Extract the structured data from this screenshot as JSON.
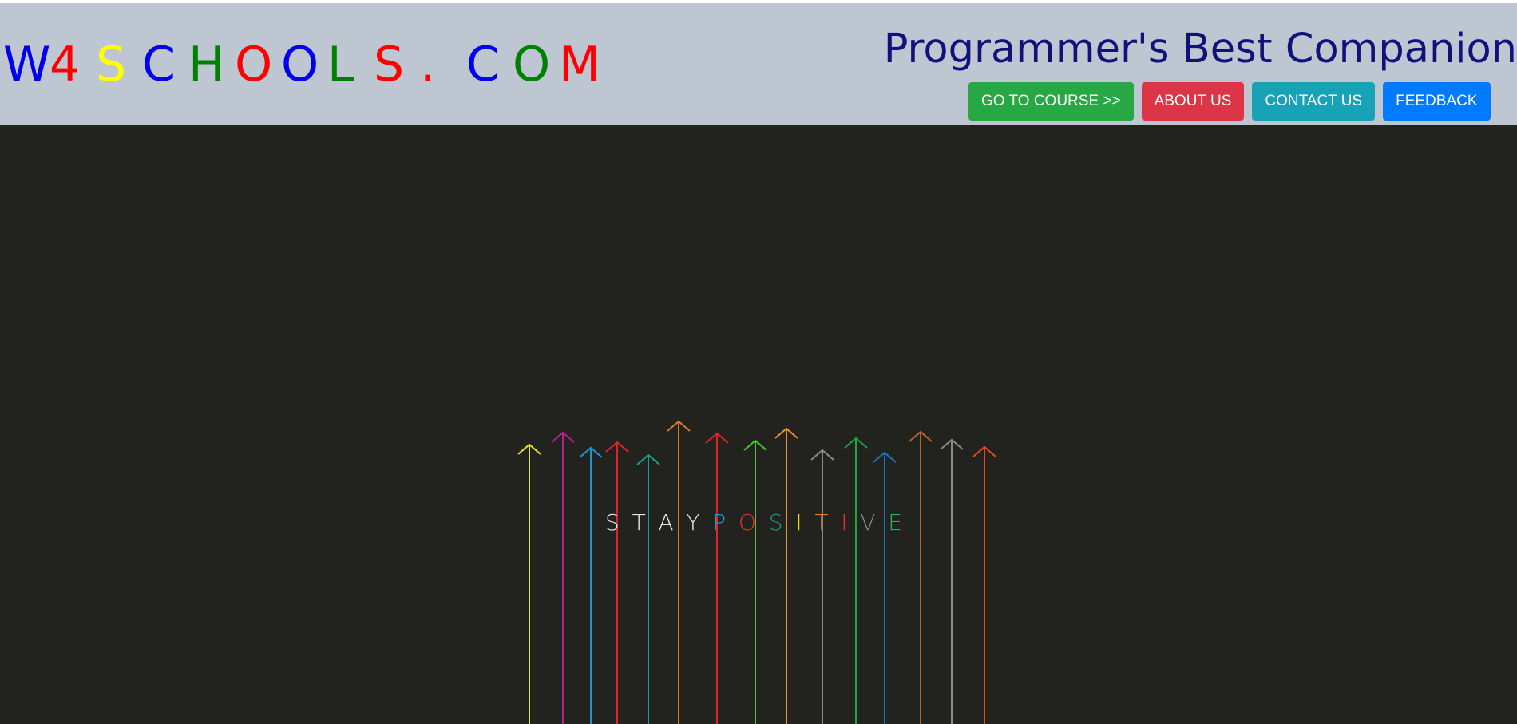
{
  "header": {
    "logo_letters": [
      {
        "char": "W",
        "color": "#0000ee"
      },
      {
        "char": "4",
        "color": "#ff0000"
      },
      {
        "char": "S",
        "color": "#ffff00"
      },
      {
        "char": "C",
        "color": "#0000ee"
      },
      {
        "char": "H",
        "color": "#008000"
      },
      {
        "char": "O",
        "color": "#ff0000"
      },
      {
        "char": "O",
        "color": "#0000ee"
      },
      {
        "char": "L",
        "color": "#008000"
      },
      {
        "char": "S",
        "color": "#ff0000"
      },
      {
        "char": ".",
        "color": "#ff0000"
      },
      {
        "char": "C",
        "color": "#0000ee"
      },
      {
        "char": "O",
        "color": "#008000"
      },
      {
        "char": "M",
        "color": "#ff0000"
      }
    ],
    "tagline": "Programmer's Best Companion",
    "tagline_color": "#11117a",
    "background_color": "#bec6d2"
  },
  "nav": {
    "buttons": [
      {
        "label": "GO TO COURSE >>",
        "color": "#28a745"
      },
      {
        "label": "ABOUT US",
        "color": "#dc3545"
      },
      {
        "label": "CONTACT US",
        "color": "#17a2b8"
      },
      {
        "label": "FEEDBACK",
        "color": "#007bff"
      }
    ]
  },
  "hero": {
    "background_color": "#22231f",
    "letters": [
      {
        "char": "S",
        "color": "#e6e6e6"
      },
      {
        "char": "T",
        "color": "#e6e6e6"
      },
      {
        "char": "A",
        "color": "#e6e6e6"
      },
      {
        "char": "Y",
        "color": "#e6e6e6"
      },
      {
        "char": "P",
        "color": "#1ba1d8"
      },
      {
        "char": "O",
        "color": "#e5322d"
      },
      {
        "char": "S",
        "color": "#16a085"
      },
      {
        "char": "I",
        "color": "#f5d90a"
      },
      {
        "char": "T",
        "color": "#e67e22"
      },
      {
        "char": "I",
        "color": "#e5322d"
      },
      {
        "char": "V",
        "color": "#7f8c8d"
      },
      {
        "char": "E",
        "color": "#27ae60"
      }
    ],
    "arrow_colors": [
      "#e8e21c",
      "#b5208f",
      "#1c97c9",
      "#e0242b",
      "#12a58c",
      "#d9792a",
      "#e0242b",
      "#4cc431",
      "#e8922a",
      "#8a8a84",
      "#1fa33f",
      "#1a74c4",
      "#b9652a",
      "#8a8a84",
      "#e8491c"
    ]
  }
}
